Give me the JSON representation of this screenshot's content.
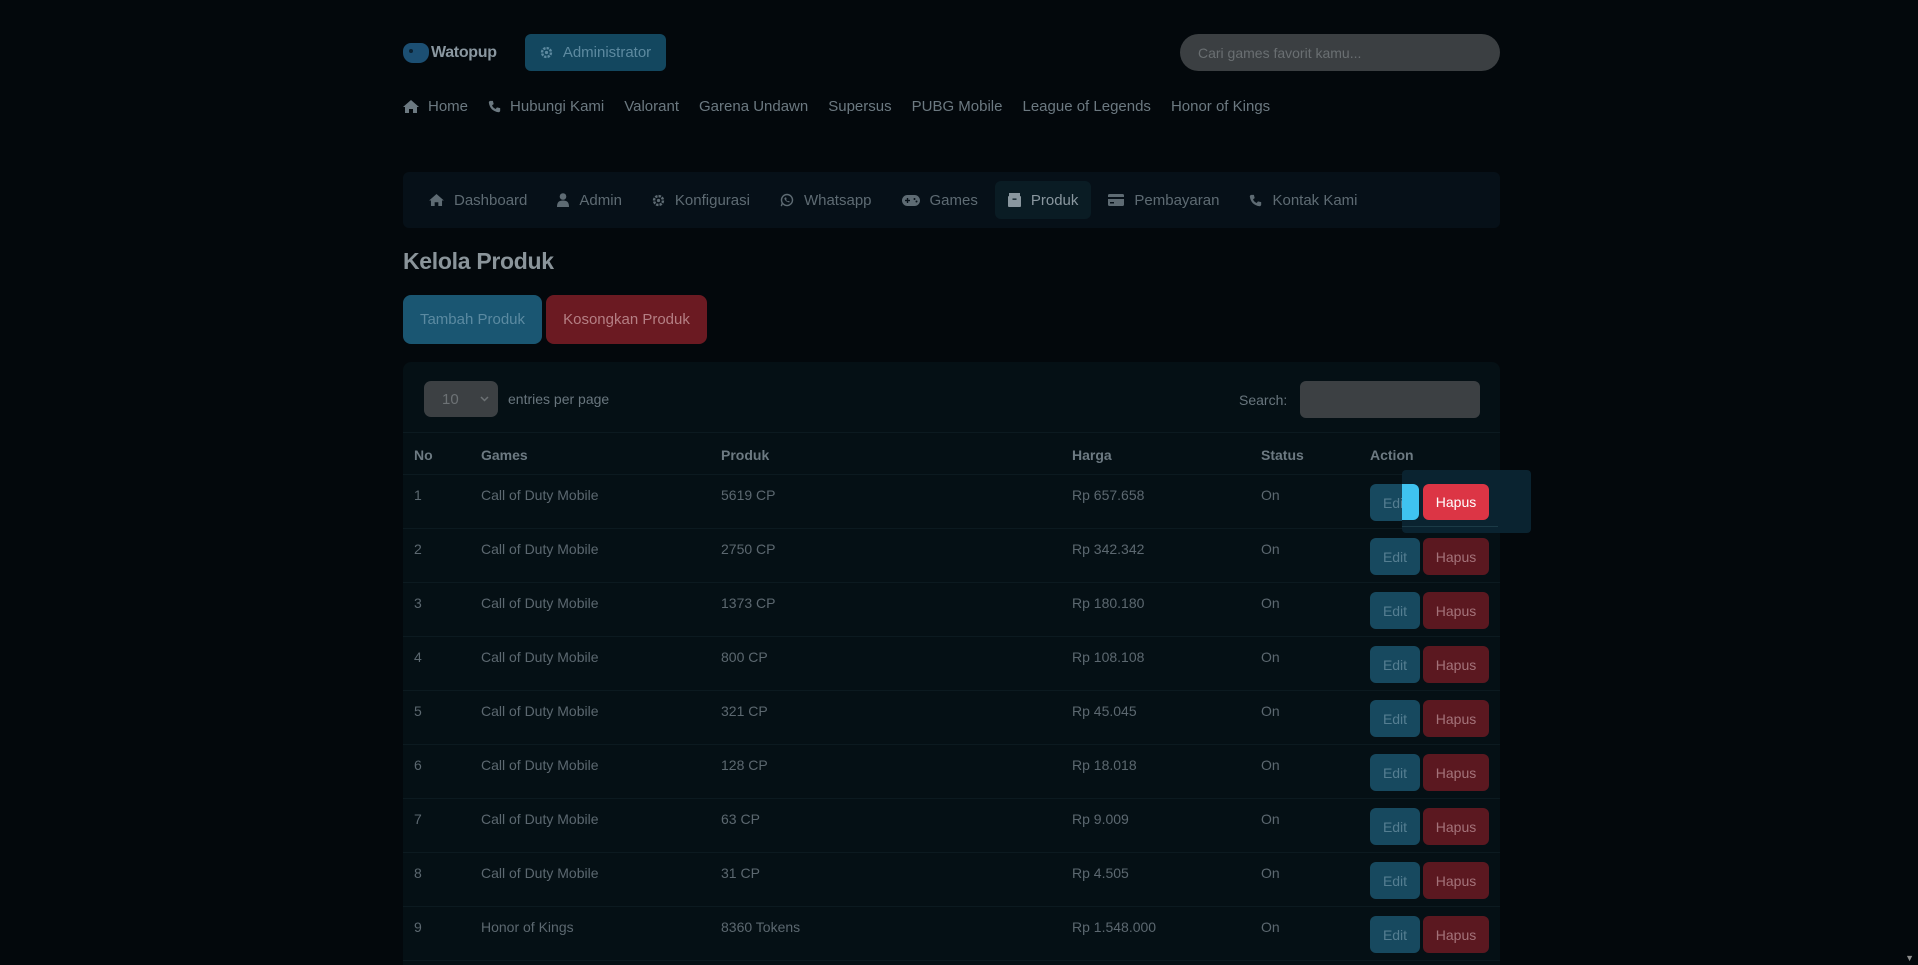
{
  "brand": {
    "name": "Watopup",
    "logo_icon": "gamepad-icon"
  },
  "header": {
    "admin_button": "Administrator",
    "search_placeholder": "Cari games favorit kamu..."
  },
  "topnav": [
    {
      "label": "Home",
      "icon": "home-icon"
    },
    {
      "label": "Hubungi Kami",
      "icon": "phone-icon"
    },
    {
      "label": "Valorant"
    },
    {
      "label": "Garena Undawn"
    },
    {
      "label": "Supersus"
    },
    {
      "label": "PUBG Mobile"
    },
    {
      "label": "League of Legends"
    },
    {
      "label": "Honor of Kings"
    }
  ],
  "adminnav": [
    {
      "label": "Dashboard",
      "icon": "home-icon"
    },
    {
      "label": "Admin",
      "icon": "user-icon"
    },
    {
      "label": "Konfigurasi",
      "icon": "gear-icon"
    },
    {
      "label": "Whatsapp",
      "icon": "whatsapp-icon"
    },
    {
      "label": "Games",
      "icon": "gamepad-icon"
    },
    {
      "label": "Produk",
      "icon": "box-icon",
      "active": true
    },
    {
      "label": "Pembayaran",
      "icon": "credit-card-icon"
    },
    {
      "label": "Kontak Kami",
      "icon": "phone-icon"
    }
  ],
  "page": {
    "title": "Kelola Produk",
    "add_button": "Tambah Produk",
    "empty_button": "Kosongkan Produk"
  },
  "table": {
    "entries_value": "10",
    "entries_label": "entries per page",
    "search_label": "Search:",
    "columns": [
      "No",
      "Games",
      "Produk",
      "Harga",
      "Status",
      "Action"
    ],
    "edit_label": "Edit",
    "delete_label": "Hapus",
    "rows": [
      {
        "no": "1",
        "game": "Call of Duty Mobile",
        "produk": "5619 CP",
        "harga": "Rp 657.658",
        "status": "On"
      },
      {
        "no": "2",
        "game": "Call of Duty Mobile",
        "produk": "2750 CP",
        "harga": "Rp 342.342",
        "status": "On"
      },
      {
        "no": "3",
        "game": "Call of Duty Mobile",
        "produk": "1373 CP",
        "harga": "Rp 180.180",
        "status": "On"
      },
      {
        "no": "4",
        "game": "Call of Duty Mobile",
        "produk": "800 CP",
        "harga": "Rp 108.108",
        "status": "On"
      },
      {
        "no": "5",
        "game": "Call of Duty Mobile",
        "produk": "321 CP",
        "harga": "Rp 45.045",
        "status": "On"
      },
      {
        "no": "6",
        "game": "Call of Duty Mobile",
        "produk": "128 CP",
        "harga": "Rp 18.018",
        "status": "On"
      },
      {
        "no": "7",
        "game": "Call of Duty Mobile",
        "produk": "63 CP",
        "harga": "Rp 9.009",
        "status": "On"
      },
      {
        "no": "8",
        "game": "Call of Duty Mobile",
        "produk": "31 CP",
        "harga": "Rp 4.505",
        "status": "On"
      },
      {
        "no": "9",
        "game": "Honor of Kings",
        "produk": "8360 Tokens",
        "harga": "Rp 1.548.000",
        "status": "On"
      }
    ]
  },
  "colors": {
    "accent": "#3fc3f0",
    "danger": "#dc3545",
    "background": "#03080c"
  }
}
